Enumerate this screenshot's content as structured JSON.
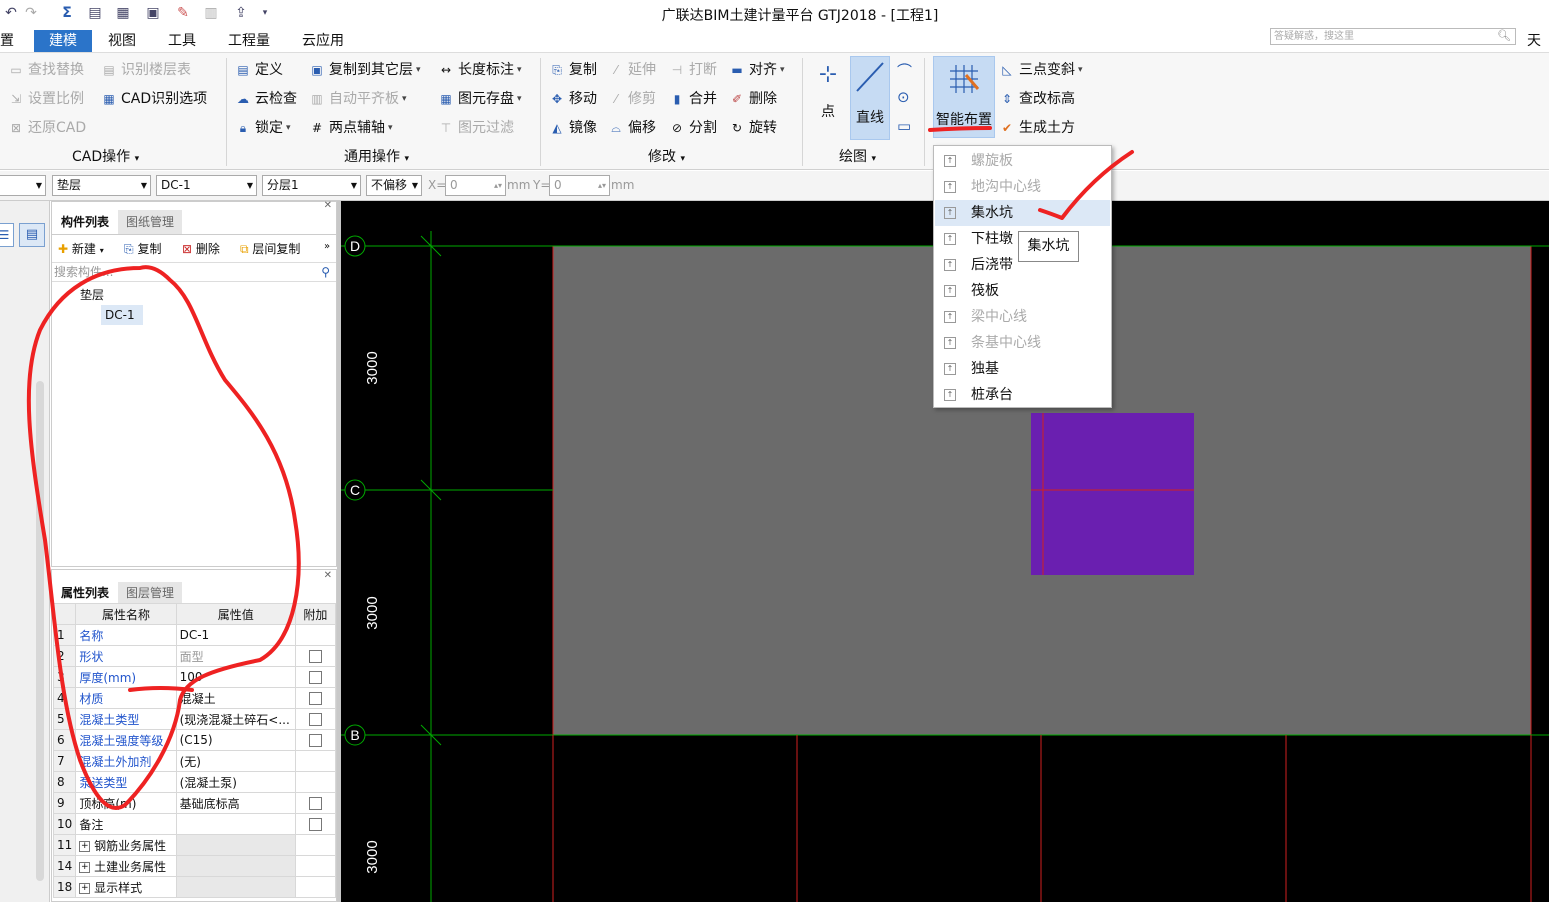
{
  "app": {
    "title": "广联达BIM土建计量平台 GTJ2018 - [工程1]"
  },
  "menubar": {
    "items": [
      {
        "label": "设置",
        "visible": "置"
      },
      {
        "label": "建模"
      },
      {
        "label": "视图"
      },
      {
        "label": "工具"
      },
      {
        "label": "工程量"
      },
      {
        "label": "云应用"
      }
    ],
    "search_placeholder": "答疑解惑，搜这里",
    "right_label": "天游"
  },
  "ribbon": {
    "cad": {
      "items": [
        "查找替换",
        "识别楼层表",
        "设置比例",
        "CAD识别选项",
        "还原CAD"
      ],
      "group": "CAD操作"
    },
    "general": {
      "items": [
        "定义",
        "复制到其它层",
        "长度标注",
        "云检查",
        "自动平齐板",
        "图元存盘",
        "锁定",
        "两点辅轴",
        "图元过滤"
      ],
      "group": "通用操作"
    },
    "modify": {
      "items": [
        "复制",
        "延伸",
        "打断",
        "对齐",
        "移动",
        "修剪",
        "合并",
        "删除",
        "镜像",
        "偏移",
        "分割",
        "旋转"
      ],
      "group": "修改"
    },
    "draw": {
      "point": "点",
      "line": "直线",
      "group": "绘图"
    },
    "smart": {
      "label": "智能布置",
      "items": [
        "三点变斜",
        "查改标高",
        "生成土方"
      ]
    }
  },
  "toolbar": {
    "type": "垫层",
    "component": "DC-1",
    "floor": "分层1",
    "offset": "不偏移",
    "x_label": "X=",
    "x_value": "0",
    "y_label": "Y=",
    "y_value": "0",
    "unit": "mm"
  },
  "component_panel": {
    "tabs": [
      "构件列表",
      "图纸管理"
    ],
    "buttons": [
      "新建",
      "复制",
      "删除",
      "层间复制"
    ],
    "search_placeholder": "搜索构件...",
    "tree": {
      "category": "垫层",
      "item": "DC-1"
    }
  },
  "property_panel": {
    "tabs": [
      "属性列表",
      "图层管理"
    ],
    "headers": [
      "属性名称",
      "属性值",
      "附加"
    ],
    "rows": [
      {
        "n": "1",
        "name": "名称",
        "value": "DC-1"
      },
      {
        "n": "2",
        "name": "形状",
        "value": "面型"
      },
      {
        "n": "3",
        "name": "厚度(mm)",
        "value": "100"
      },
      {
        "n": "4",
        "name": "材质",
        "value": "混凝土"
      },
      {
        "n": "5",
        "name": "混凝土类型",
        "value": "(现浇混凝土碎石<..."
      },
      {
        "n": "6",
        "name": "混凝土强度等级",
        "value": "(C15)"
      },
      {
        "n": "7",
        "name": "混凝土外加剂",
        "value": "(无)"
      },
      {
        "n": "8",
        "name": "泵送类型",
        "value": "(混凝土泵)"
      },
      {
        "n": "9",
        "name": "顶标高(m)",
        "value": "基础底标高"
      },
      {
        "n": "10",
        "name": "备注",
        "value": ""
      },
      {
        "n": "11",
        "name": "钢筋业务属性",
        "value": ""
      },
      {
        "n": "14",
        "name": "土建业务属性",
        "value": ""
      },
      {
        "n": "18",
        "name": "显示样式",
        "value": ""
      }
    ]
  },
  "canvas": {
    "axes": [
      "D",
      "C",
      "B"
    ],
    "dims": [
      "3000",
      "3000",
      "3000"
    ]
  },
  "dropdown": {
    "items": [
      {
        "label": "螺旋板",
        "enabled": false
      },
      {
        "label": "地沟中心线",
        "enabled": false
      },
      {
        "label": "集水坑",
        "enabled": true
      },
      {
        "label": "下柱墩",
        "enabled": true
      },
      {
        "label": "后浇带",
        "enabled": true
      },
      {
        "label": "筏板",
        "enabled": true
      },
      {
        "label": "梁中心线",
        "enabled": false
      },
      {
        "label": "条基中心线",
        "enabled": false
      },
      {
        "label": "独基",
        "enabled": true
      },
      {
        "label": "桩承台",
        "enabled": true
      }
    ],
    "tooltip": "集水坑"
  },
  "colors": {
    "accent": "#2b74c9",
    "slab": "#6b6b6b",
    "pit": "#6a1fb0",
    "axis": "#00aa00",
    "annotation": "#ee2222"
  }
}
